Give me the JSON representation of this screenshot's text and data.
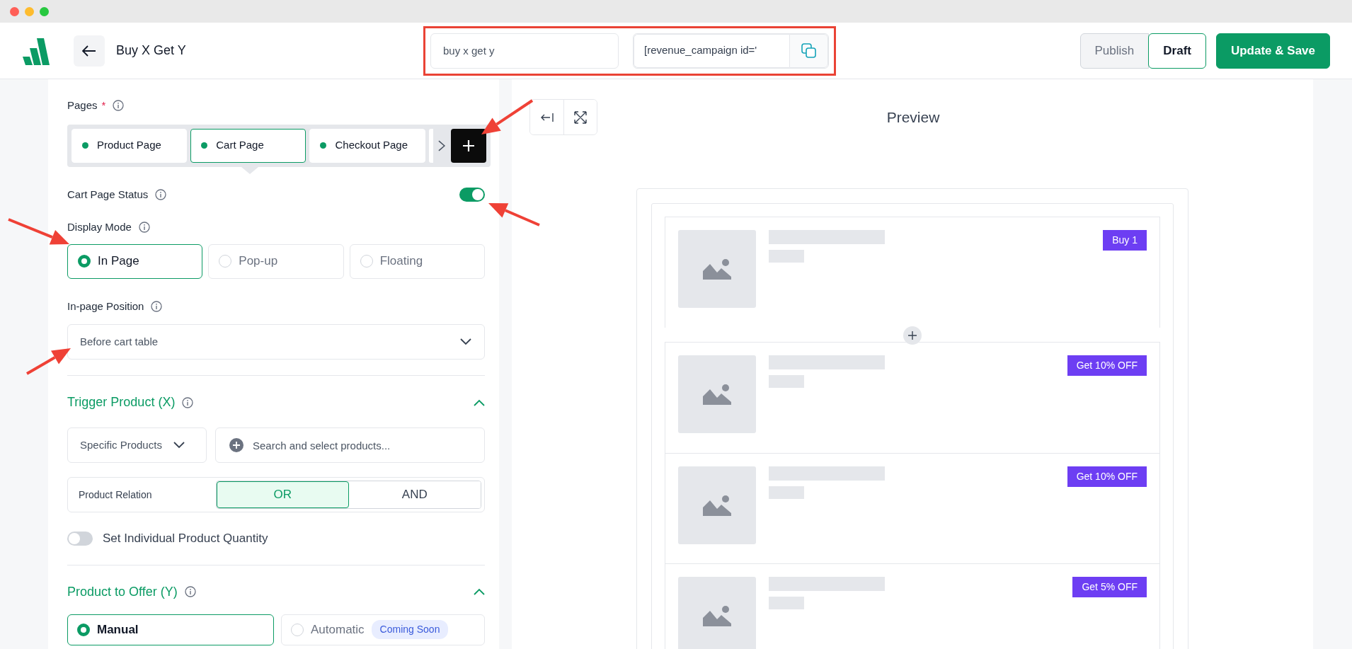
{
  "header": {
    "title": "Buy X Get Y",
    "campaign_name": "buy x get y",
    "shortcode": "[revenue_campaign id='",
    "actions": [
      {
        "label": "Publish",
        "kind": "muted"
      },
      {
        "label": "Draft",
        "kind": "outline"
      },
      {
        "label": "Update & Save",
        "kind": "primary"
      }
    ]
  },
  "pages": {
    "label": "Pages",
    "required_mark": "*",
    "tabs": [
      {
        "label": "Product Page",
        "selected": false
      },
      {
        "label": "Cart Page",
        "selected": true
      },
      {
        "label": "Checkout Page",
        "selected": false
      }
    ]
  },
  "status": {
    "label": "Cart Page Status",
    "on": true
  },
  "display_mode": {
    "label": "Display Mode",
    "options": [
      {
        "label": "In Page",
        "selected": true
      },
      {
        "label": "Pop-up",
        "selected": false
      },
      {
        "label": "Floating",
        "selected": false
      }
    ]
  },
  "position": {
    "label": "In-page Position",
    "value": "Before cart table"
  },
  "trigger": {
    "title": "Trigger Product (X)",
    "expanded": true,
    "filter": "Specific Products",
    "search_placeholder": "Search and select products...",
    "relation": {
      "label": "Product Relation",
      "options": [
        {
          "label": "OR",
          "selected": true
        },
        {
          "label": "AND",
          "selected": false
        }
      ]
    },
    "quantity": {
      "label": "Set Individual Product Quantity",
      "on": false
    }
  },
  "offer": {
    "title": "Product to Offer (Y)",
    "expanded": true,
    "options": [
      {
        "label": "Manual",
        "selected": true
      },
      {
        "label": "Automatic",
        "selected": false,
        "badge": "Coming Soon"
      }
    ]
  },
  "preview": {
    "title": "Preview",
    "items": [
      {
        "badge": "Buy 1"
      },
      {
        "badge": "Get 10% OFF"
      },
      {
        "badge": "Get 10% OFF"
      },
      {
        "badge": "Get 5% OFF"
      }
    ]
  }
}
